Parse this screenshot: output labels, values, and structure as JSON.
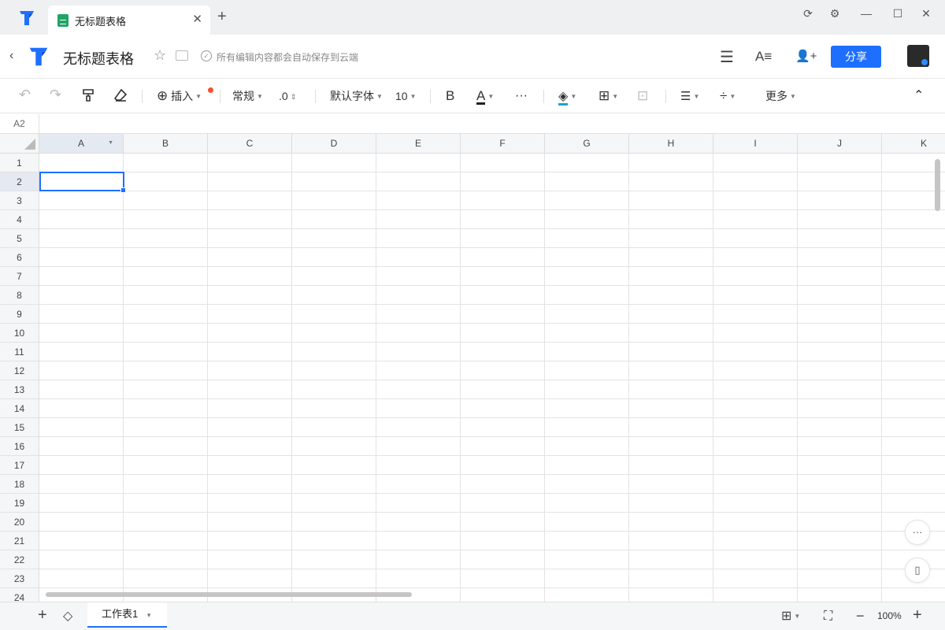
{
  "window": {
    "tab_title": "无标题表格",
    "tab_close": "✕",
    "new_tab": "+",
    "controls": {
      "sync": "⟳",
      "settings": "⚙",
      "minimize": "—",
      "maximize": "☐",
      "close": "✕"
    }
  },
  "header": {
    "back": "‹",
    "title": "无标题表格",
    "star": "☆",
    "save_status": "所有编辑内容都会自动保存到云端",
    "menu_icon": "☰",
    "text_style_icon": "A≡",
    "add_user_icon": "👤+",
    "share_label": "分享"
  },
  "toolbar": {
    "undo": "↶",
    "redo": "↷",
    "format_painter": "🖌",
    "eraser": "⌫",
    "insert": "插入",
    "format": "常规",
    "decimal": ".0",
    "font": "默认字体",
    "font_size": "10",
    "bold": "B",
    "font_color": "A",
    "more_dots": "···",
    "fill_color": "◈",
    "borders": "⊞",
    "merge": "⊡",
    "align": "☰",
    "valign": "÷",
    "more": "更多",
    "collapse": "⌃"
  },
  "formula_bar": {
    "cell_ref": "A2"
  },
  "grid": {
    "columns": [
      "A",
      "B",
      "C",
      "D",
      "E",
      "F",
      "G",
      "H",
      "I",
      "J",
      "K"
    ],
    "active_column": "A",
    "rows": [
      "1",
      "2",
      "3",
      "4",
      "5",
      "6",
      "7",
      "8",
      "9",
      "10",
      "11",
      "12",
      "13",
      "14",
      "15",
      "16",
      "17",
      "18",
      "19",
      "20",
      "21",
      "22",
      "23",
      "24"
    ],
    "active_row": "2"
  },
  "floating": {
    "more": "···",
    "mobile": "▯"
  },
  "bottom_bar": {
    "add_sheet": "+",
    "layers": "◇",
    "sheet_name": "工作表1",
    "sheet_caret": "▾",
    "grid_view": "⊞",
    "fullscreen": "⛶",
    "zoom_out": "−",
    "zoom_level": "100%",
    "zoom_in": "+"
  },
  "colors": {
    "accent": "#1e6fff",
    "sheet_green": "#1fa463",
    "badge_red": "#f55030"
  }
}
